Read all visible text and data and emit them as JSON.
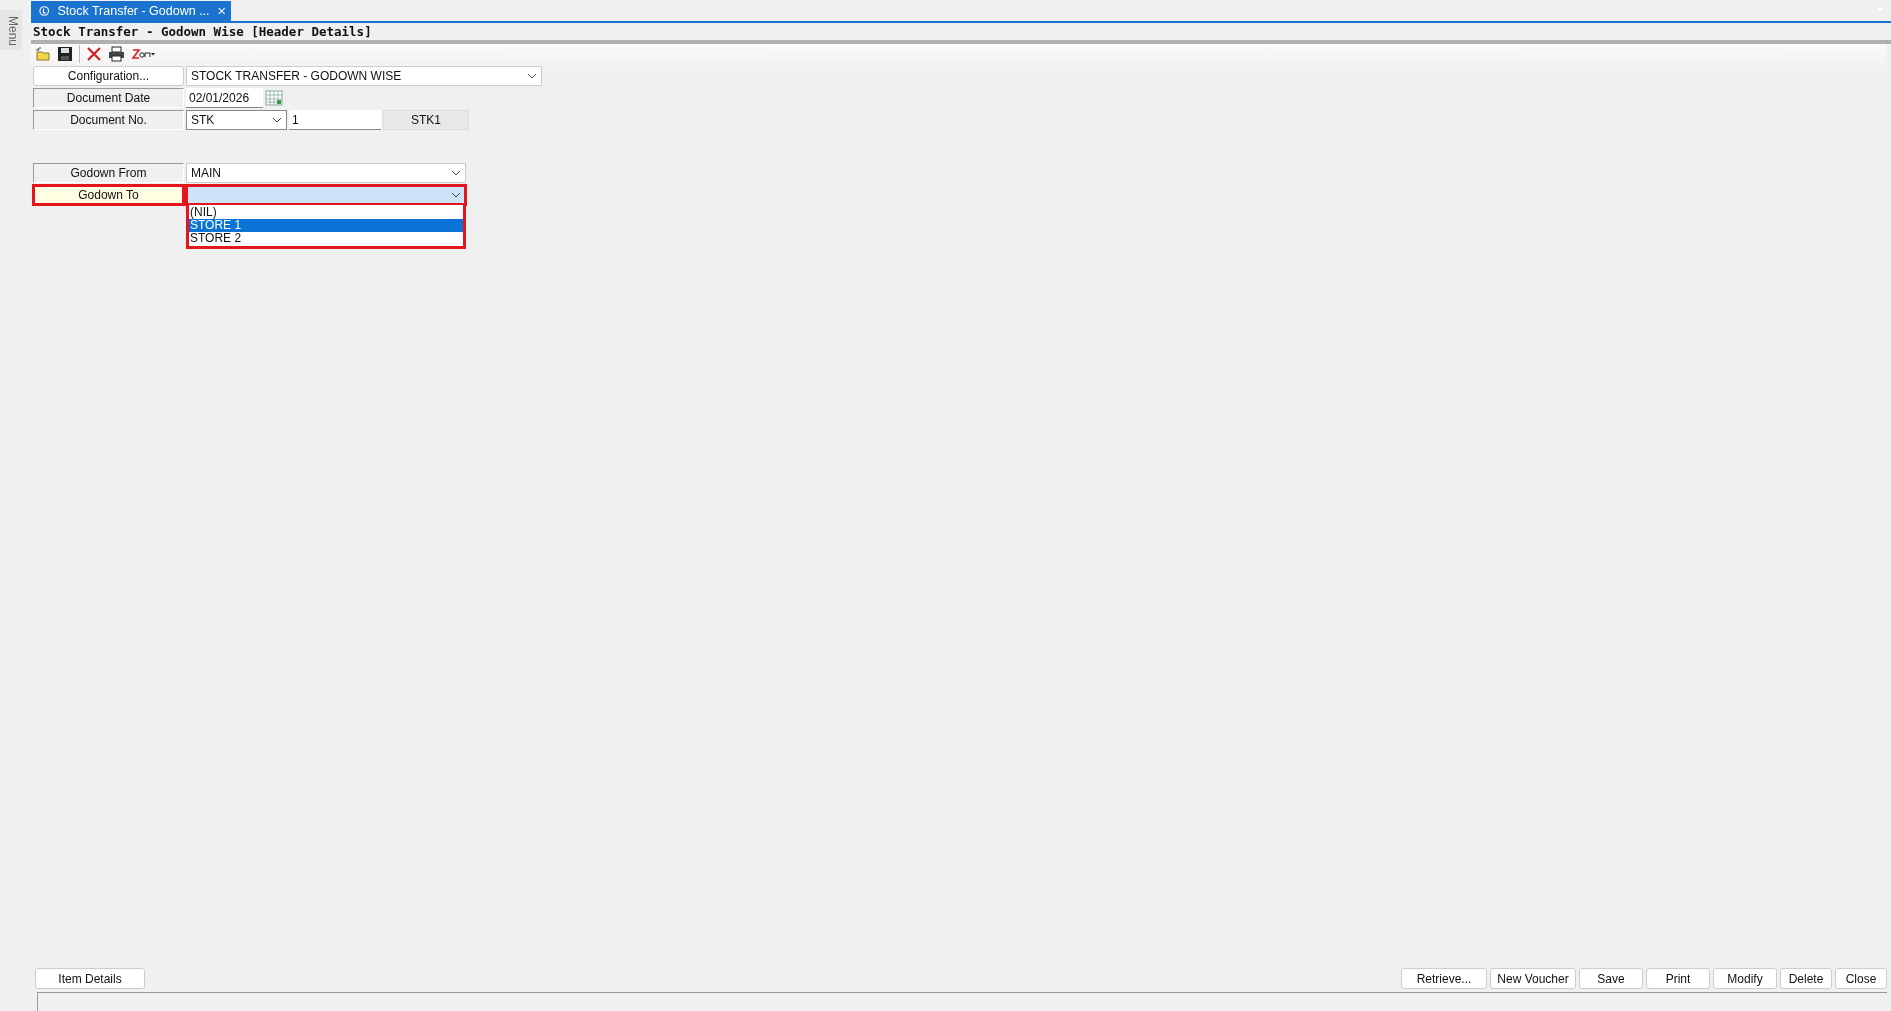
{
  "side_menu": {
    "label": "Menu"
  },
  "tab": {
    "title": "Stock Transfer - Godown ...",
    "selected": true
  },
  "form_title": "Stock Transfer - Godown Wise [Header Details]",
  "configuration": {
    "button": "Configuration...",
    "value": "STOCK TRANSFER - GODOWN WISE"
  },
  "document_date": {
    "label": "Document Date",
    "value": "02/01/2026"
  },
  "document_no": {
    "label": "Document No.",
    "series": "STK",
    "number": "1",
    "code": "STK1"
  },
  "godown_from": {
    "label": "Godown From",
    "value": "MAIN",
    "focused": false
  },
  "godown_to": {
    "label": "Godown To",
    "focused": true,
    "expanded": true,
    "options": [
      {
        "label": "(NIL)",
        "selected": false
      },
      {
        "label": "STORE 1",
        "selected": true
      },
      {
        "label": "STORE 2",
        "selected": false
      }
    ]
  },
  "left_buttons": [
    "Item Details"
  ],
  "right_buttons": [
    "Retrieve...",
    "New Voucher",
    "Save",
    "Print",
    "Modify",
    "Delete",
    "Close"
  ]
}
